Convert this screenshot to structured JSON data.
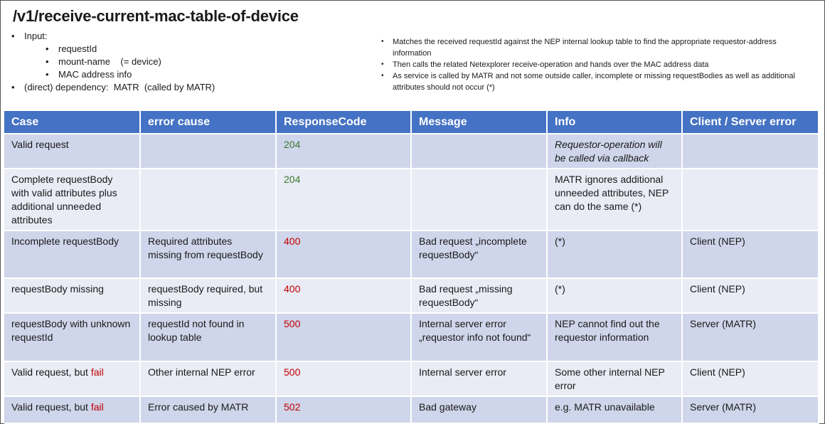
{
  "title": "/v1/receive-current-mac-table-of-device",
  "left_list": {
    "input_label": "Input:",
    "inputs": [
      "requestId",
      "mount-name    (= device)",
      "MAC address info"
    ],
    "dependency": "(direct) dependency:  MATR  (called by MATR)"
  },
  "right_list": [
    "Matches the received requestId against the NEP internal lookup table to find the appropriate requestor-address information",
    "Then calls the related Netexplorer  receive-operation and hands over the MAC  address data",
    "As service is called by MATR and not some outside caller, incomplete or missing requestBodies as well as additional attributes should not occur (*)"
  ],
  "table": {
    "headers": [
      "Case",
      "error cause",
      "ResponseCode",
      "Message",
      "Info",
      "Client / Server error"
    ],
    "rows": [
      {
        "case": "Valid request",
        "cause": "",
        "code": "204",
        "message": "",
        "info": "Requestor-operation will be called via callback",
        "client_server": ""
      },
      {
        "case": "Complete requestBody with valid attributes plus additional unneeded attributes",
        "cause": "",
        "code": "204",
        "message": "",
        "info": "MATR ignores additional unneeded attributes, NEP can do the same (*)",
        "client_server": ""
      },
      {
        "case": "Incomplete requestBody",
        "cause": "Required attributes missing from requestBody",
        "code": "400",
        "message": "Bad request „incomplete requestBody“",
        "info": "(*)",
        "client_server": "Client (NEP)"
      },
      {
        "case": "requestBody missing",
        "cause": "requestBody required, but missing",
        "code": "400",
        "message": "Bad request „missing requestBody“",
        "info": "(*)",
        "client_server": "Client (NEP)"
      },
      {
        "case": "requestBody with unknown requestId",
        "cause": "requestId not found in lookup table",
        "code": "500",
        "message": "Internal server error „requestor info not found“",
        "info": "NEP cannot find out the requestor information",
        "client_server": "Server (MATR)"
      },
      {
        "case_prefix": "Valid request, but ",
        "case_fail": "fail",
        "cause": "Other internal NEP error",
        "code": "500",
        "message": "Internal server error",
        "info": "Some other internal NEP error",
        "client_server": "Client (NEP)"
      },
      {
        "case_prefix": "Valid request, but ",
        "case_fail": "fail",
        "cause": "Error caused by MATR",
        "code": "502",
        "message": "Bad gateway",
        "info": "e.g. MATR unavailable",
        "client_server": "Server (MATR)"
      }
    ]
  },
  "colors": {
    "header_bg": "#4472c4",
    "row_dark": "#cfd5ea",
    "row_light": "#e9ebf5",
    "code_success": "#3d7a2e",
    "code_error": "#c00000"
  }
}
